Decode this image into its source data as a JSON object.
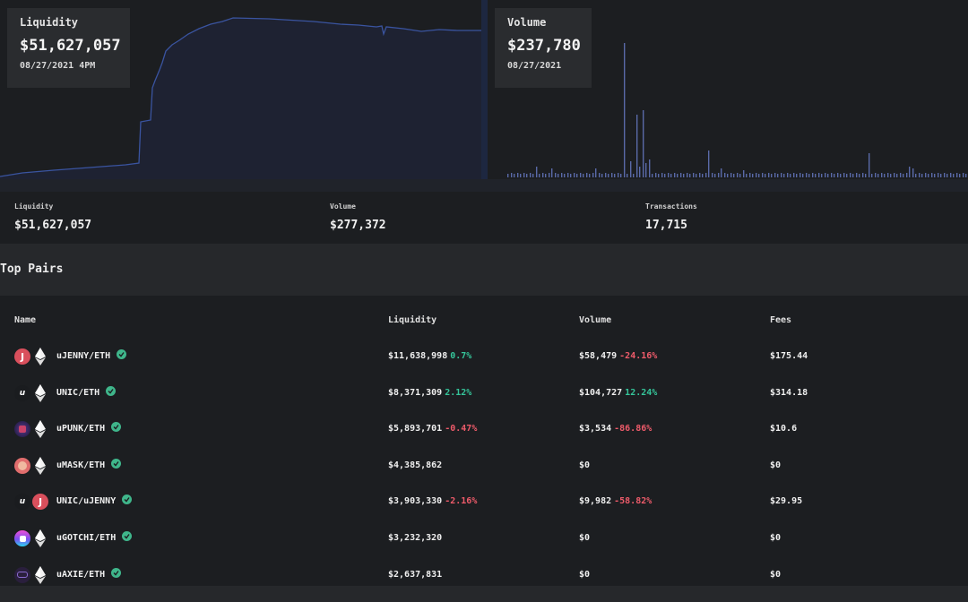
{
  "liquidity_chart": {
    "tooltip_label": "Liquidity",
    "tooltip_value": "$51,627,057",
    "tooltip_date": "08/27/2021 4PM",
    "line_color": "#3a54a0",
    "fill_color": "#1e2232"
  },
  "volume_chart": {
    "tooltip_label": "Volume",
    "tooltip_value": "$237,780",
    "tooltip_date": "08/27/2021",
    "bar_color": "#5a6aa8"
  },
  "stats": {
    "liquidity_label": "Liquidity",
    "liquidity_value": "$51,627,057",
    "volume_label": "Volume",
    "volume_value": "$277,372",
    "transactions_label": "Transactions",
    "transactions_value": "17,715"
  },
  "section_title": "Top Pairs",
  "table": {
    "headers": {
      "name": "Name",
      "liquidity": "Liquidity",
      "volume": "Volume",
      "fees": "Fees"
    },
    "rows": [
      {
        "name": "uJENNY/ETH",
        "icon1": "jenny-token-icon",
        "icon2": "eth-icon",
        "liquidity": "$11,638,998",
        "liquidity_change": "0.7%",
        "liquidity_dir": "pos",
        "volume": "$58,479",
        "volume_change": "-24.16%",
        "volume_dir": "neg",
        "fees": "$175.44"
      },
      {
        "name": "UNIC/ETH",
        "icon1": "unic-token-icon",
        "icon2": "eth-icon",
        "liquidity": "$8,371,309",
        "liquidity_change": "2.12%",
        "liquidity_dir": "pos",
        "volume": "$104,727",
        "volume_change": "12.24%",
        "volume_dir": "pos",
        "fees": "$314.18"
      },
      {
        "name": "uPUNK/ETH",
        "icon1": "punk-token-icon",
        "icon2": "eth-icon",
        "liquidity": "$5,893,701",
        "liquidity_change": "-0.47%",
        "liquidity_dir": "neg",
        "volume": "$3,534",
        "volume_change": "-86.86%",
        "volume_dir": "neg",
        "fees": "$10.6"
      },
      {
        "name": "uMASK/ETH",
        "icon1": "mask-token-icon",
        "icon2": "eth-icon",
        "liquidity": "$4,385,862",
        "liquidity_change": "",
        "liquidity_dir": "",
        "volume": "$0",
        "volume_change": "",
        "volume_dir": "",
        "fees": "$0"
      },
      {
        "name": "UNIC/uJENNY",
        "icon1": "unic-token-icon",
        "icon2": "jenny-token-icon",
        "liquidity": "$3,903,330",
        "liquidity_change": "-2.16%",
        "liquidity_dir": "neg",
        "volume": "$9,982",
        "volume_change": "-58.82%",
        "volume_dir": "neg",
        "fees": "$29.95"
      },
      {
        "name": "uGOTCHI/ETH",
        "icon1": "gotchi-token-icon",
        "icon2": "eth-icon",
        "liquidity": "$3,232,320",
        "liquidity_change": "",
        "liquidity_dir": "",
        "volume": "$0",
        "volume_change": "",
        "volume_dir": "",
        "fees": "$0"
      },
      {
        "name": "uAXIE/ETH",
        "icon1": "axie-token-icon",
        "icon2": "eth-icon",
        "liquidity": "$2,637,831",
        "liquidity_change": "",
        "liquidity_dir": "",
        "volume": "$0",
        "volume_change": "",
        "volume_dir": "",
        "fees": "$0"
      }
    ]
  },
  "colors": {
    "positive": "#35c59a",
    "negative": "#ee5b6a",
    "verified": "#3fb68b"
  }
}
